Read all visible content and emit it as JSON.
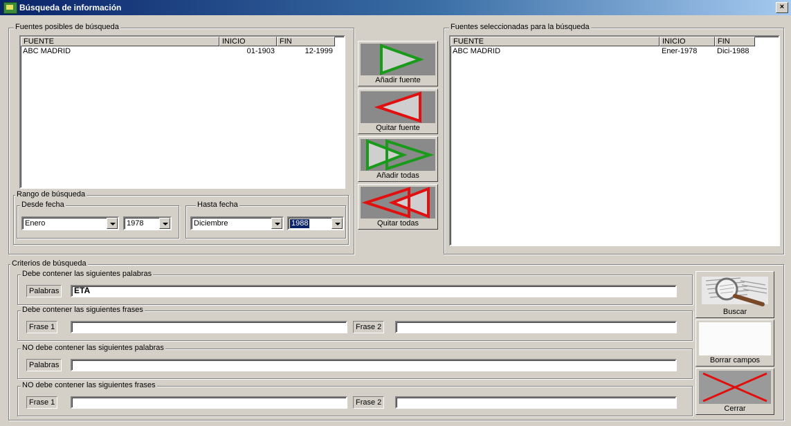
{
  "window": {
    "title": "Búsqueda de información",
    "close": "×"
  },
  "possible_sources": {
    "title": "Fuentes posibles de búsqueda",
    "columns": [
      "FUENTE",
      "INICIO",
      "FIN"
    ],
    "rows": [
      {
        "fuente": "ABC MADRID",
        "inicio": "01-1903",
        "fin": "12-1999"
      }
    ]
  },
  "selected_sources": {
    "title": "Fuentes seleccionadas para la búsqueda",
    "columns": [
      "FUENTE",
      "INICIO",
      "FIN"
    ],
    "rows": [
      {
        "fuente": "ABC MADRID",
        "inicio": "Ener-1978",
        "fin": "Dici-1988"
      }
    ]
  },
  "range": {
    "title": "Rango de búsqueda",
    "from": {
      "title": "Desde fecha",
      "month": "Enero",
      "year": "1978"
    },
    "to": {
      "title": "Hasta fecha",
      "month": "Diciembre",
      "year": "1988"
    }
  },
  "actions": {
    "add_source": "Añadir fuente",
    "remove_source": "Quitar fuente",
    "add_all": "Añadir todas",
    "remove_all": "Quitar todas"
  },
  "criteria": {
    "title": "Criterios de búsqueda",
    "must_words": {
      "title": "Debe contener las siguientes palabras",
      "label": "Palabras",
      "value": "ETA"
    },
    "must_phrases": {
      "title": "Debe contener las siguientes frases",
      "label1": "Frase 1",
      "value1": "",
      "label2": "Frase 2",
      "value2": ""
    },
    "not_words": {
      "title": "NO debe contener las siguientes palabras",
      "label": "Palabras",
      "value": ""
    },
    "not_phrases": {
      "title": "NO debe contener las siguientes frases",
      "label1": "Frase 1",
      "value1": "",
      "label2": "Frase 2",
      "value2": ""
    }
  },
  "side_buttons": {
    "search": "Buscar",
    "clear": "Borrar campos",
    "close": "Cerrar"
  },
  "colors": {
    "add": "#1a9a1a",
    "remove": "#e01010"
  }
}
